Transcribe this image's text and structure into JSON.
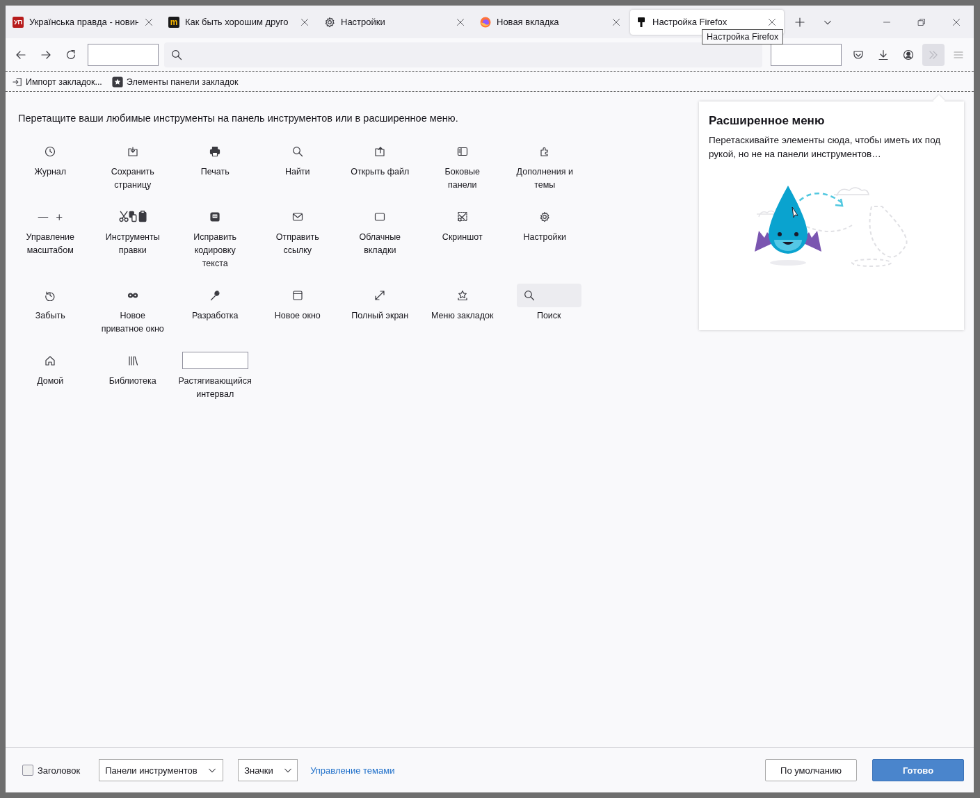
{
  "tabs": [
    {
      "label": "Українська правда - новин",
      "badge": "УП",
      "selected": false
    },
    {
      "label": "Как быть хорошим друго",
      "badge": "m",
      "selected": false
    },
    {
      "label": "Настройки",
      "selected": false
    },
    {
      "label": "Новая вкладка",
      "selected": false
    },
    {
      "label": "Настройка Firefox",
      "selected": true
    }
  ],
  "tooltip": "Настройка Firefox",
  "bookmarks_toolbar": [
    {
      "label": "Импорт закладок..."
    },
    {
      "label": "Элементы панели закладок"
    }
  ],
  "palette": {
    "instruction": "Перетащите ваши любимые инструменты на панель инструментов или в расширенное меню.",
    "items": [
      {
        "label": "Журнал",
        "kind": "button"
      },
      {
        "label": "Сохранить страницу",
        "kind": "button"
      },
      {
        "label": "Печать",
        "kind": "button"
      },
      {
        "label": "Найти",
        "kind": "button"
      },
      {
        "label": "Открыть файл",
        "kind": "button"
      },
      {
        "label": "Боковые панели",
        "kind": "button"
      },
      {
        "label": "Дополнения и темы",
        "kind": "button"
      },
      {
        "label": "Управление масштабом",
        "kind": "button"
      },
      {
        "label": "Инструменты правки",
        "kind": "button"
      },
      {
        "label": "Исправить кодировку текста",
        "kind": "button"
      },
      {
        "label": "Отправить ссылку",
        "kind": "button"
      },
      {
        "label": "Облачные вкладки",
        "kind": "button"
      },
      {
        "label": "Скриншот",
        "kind": "button"
      },
      {
        "label": "Настройки",
        "kind": "button"
      },
      {
        "label": "Забыть",
        "kind": "button"
      },
      {
        "label": "Новое приватное окно",
        "kind": "button"
      },
      {
        "label": "Разработка",
        "kind": "button"
      },
      {
        "label": "Новое окно",
        "kind": "button"
      },
      {
        "label": "Полный экран",
        "kind": "button"
      },
      {
        "label": "Меню закладок",
        "kind": "button"
      },
      {
        "label": "Поиск",
        "kind": "search"
      },
      {
        "label": "Домой",
        "kind": "button"
      },
      {
        "label": "Библиотека",
        "kind": "button"
      },
      {
        "label": "Растягивающийся интервал",
        "kind": "spring"
      }
    ]
  },
  "overflow_panel": {
    "title": "Расширенное меню",
    "description": "Перетаскивайте элементы сюда, чтобы иметь их под рукой, но не на панели инструментов…"
  },
  "footer": {
    "title_bar": {
      "label": "Заголовок",
      "checked": false
    },
    "toolbars_select": "Панели инструментов",
    "density_select": "Значки",
    "themes_link": "Управление темами",
    "buttons": [
      {
        "label": "По умолчанию",
        "kind": "secondary"
      },
      {
        "label": "Готово",
        "kind": "primary"
      }
    ]
  }
}
